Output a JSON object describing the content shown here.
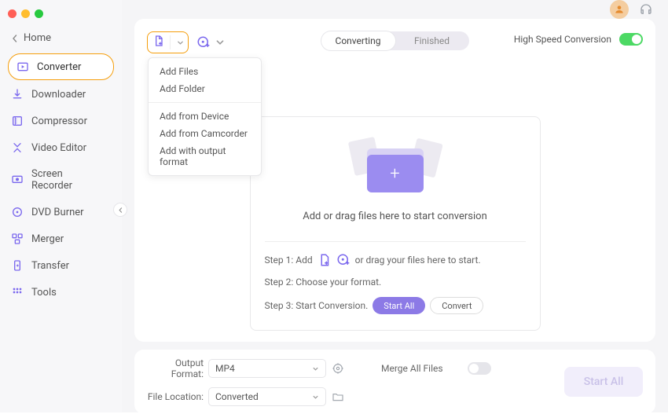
{
  "home_label": "Home",
  "sidebar": {
    "items": [
      {
        "label": "Converter",
        "icon": "converter",
        "active": true
      },
      {
        "label": "Downloader",
        "icon": "downloader"
      },
      {
        "label": "Compressor",
        "icon": "compressor"
      },
      {
        "label": "Video Editor",
        "icon": "video-editor"
      },
      {
        "label": "Screen Recorder",
        "icon": "screen-recorder"
      },
      {
        "label": "DVD Burner",
        "icon": "dvd-burner"
      },
      {
        "label": "Merger",
        "icon": "merger"
      },
      {
        "label": "Transfer",
        "icon": "transfer"
      },
      {
        "label": "Tools",
        "icon": "tools"
      }
    ]
  },
  "toolbar": {
    "tabs": {
      "converting": "Converting",
      "finished": "Finished"
    },
    "hsc_label": "High Speed Conversion",
    "hsc_on": true
  },
  "dropdown": {
    "group1": [
      "Add Files",
      "Add Folder"
    ],
    "group2": [
      "Add from Device",
      "Add from Camcorder",
      "Add with output format"
    ]
  },
  "dropzone": {
    "title": "Add or drag files here to start conversion",
    "step1_prefix": "Step 1: Add",
    "step1_suffix": "or drag your files here to start.",
    "step2": "Step 2: Choose your format.",
    "step3": "Step 3: Start Conversion.",
    "btn_start_all": "Start  All",
    "btn_convert": "Convert"
  },
  "bottom": {
    "output_format_label": "Output Format:",
    "output_format_value": "MP4",
    "file_location_label": "File Location:",
    "file_location_value": "Converted",
    "merge_label": "Merge All Files",
    "start_all": "Start All"
  }
}
